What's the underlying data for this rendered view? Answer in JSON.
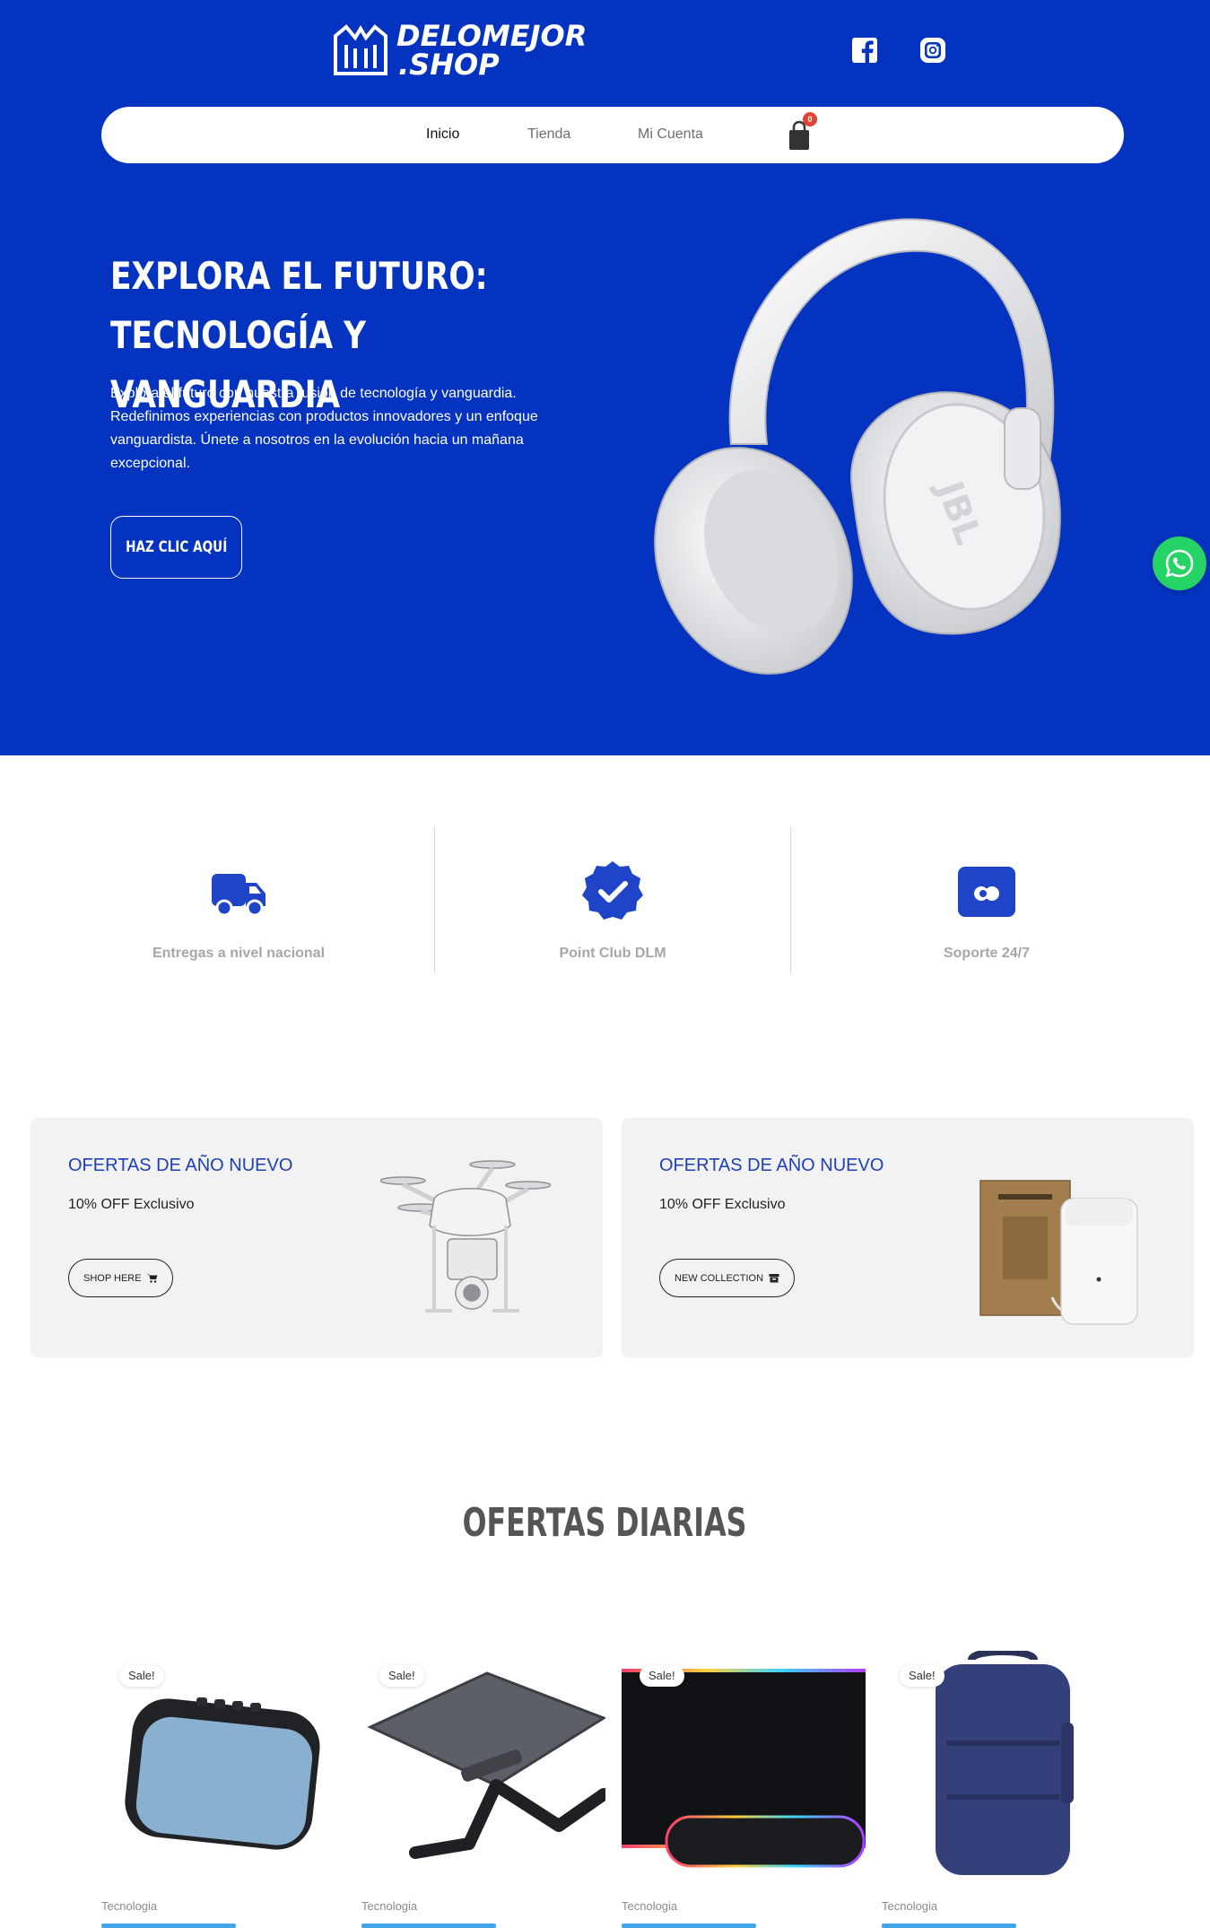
{
  "brand": {
    "line1": "DELOMEJOR",
    "line2": ".SHOP"
  },
  "header": {
    "social": [
      "facebook-icon",
      "instagram-icon"
    ]
  },
  "nav": {
    "items": [
      {
        "label": "Inicio",
        "active": true
      },
      {
        "label": "Tienda",
        "active": false
      },
      {
        "label": "Mi Cuenta",
        "active": false
      }
    ],
    "cart_count": "0"
  },
  "hero": {
    "title_line1": "EXPLORA EL FUTURO:",
    "title_line2": "TECNOLOGÍA Y VANGUARDIA",
    "description": "Explora el futuro con nuestra fusión de tecnología y vanguardia. Redefinimos experiencias con productos innovadores y un enfoque vanguardista. Únete a nosotros en la evolución hacia un mañana excepcional.",
    "button": "HAZ CLIC AQUÍ",
    "image_brand": "JBL"
  },
  "features": [
    {
      "label": "Entregas a nivel nacional",
      "icon": "truck-icon"
    },
    {
      "label": "Point Club DLM",
      "icon": "verified-badge-icon"
    },
    {
      "label": "Soporte 24/7",
      "icon": "support-icon"
    }
  ],
  "offers": [
    {
      "title": "OFERTAS DE AÑO NUEVO",
      "subtitle": "10% OFF Exclusivo",
      "button": "SHOP HERE",
      "button_icon": "cart-icon",
      "image": "drone"
    },
    {
      "title": "OFERTAS DE AÑO NUEVO",
      "subtitle": "10% OFF Exclusivo",
      "button": "NEW COLLECTION",
      "button_icon": "box-icon",
      "image": "air-purifier"
    }
  ],
  "daily": {
    "title": "OFERTAS DIARIAS",
    "products": [
      {
        "badge": "Sale!",
        "category": "Tecnologia",
        "image": "bluetooth-speaker"
      },
      {
        "badge": "Sale!",
        "category": "Tecnologia",
        "image": "laptop-stand"
      },
      {
        "badge": "Sale!",
        "category": "Tecnologia",
        "image": "rgb-mousepad"
      },
      {
        "badge": "Sale!",
        "category": "Tecnologia",
        "image": "backpack"
      }
    ]
  },
  "colors": {
    "primary": "#0433c0",
    "accent_text": "#1d3fb8",
    "whatsapp": "#25d366",
    "badge": "#e0432f"
  }
}
